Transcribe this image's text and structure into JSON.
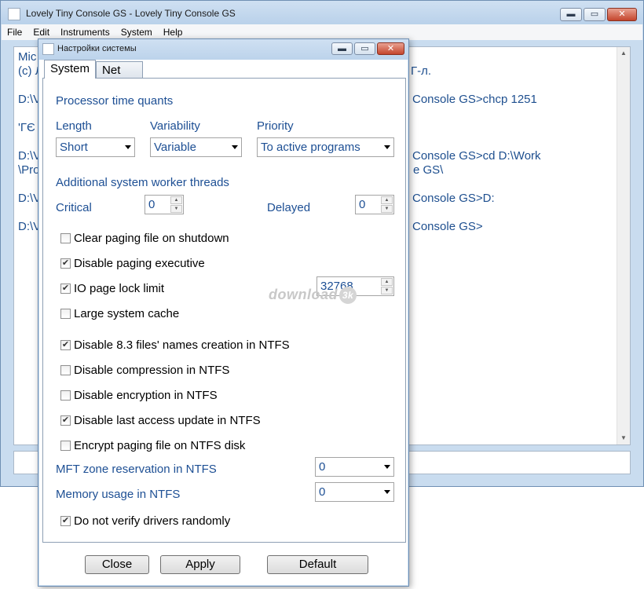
{
  "main_window": {
    "title": "Lovely Tiny Console GS - Lovely Tiny Console GS",
    "buttons": {
      "minimize": "▬",
      "maximize": "▭",
      "close": "✕"
    },
    "menu": [
      "File",
      "Edit",
      "Instruments",
      "System",
      "Help"
    ]
  },
  "console": {
    "left_lines": [
      "Mic",
      "(c) Л",
      "D:\\V",
      "'ГЄ",
      "D:\\V",
      "\\Pro",
      "D:\\V",
      "D:\\V"
    ],
    "right_lines": [
      "Г-л.",
      "Console GS>chcp 1251",
      "Console GS>cd D:\\Work",
      "e GS\\",
      "Console GS>D:",
      "Console GS>"
    ]
  },
  "dialog": {
    "title": "Настройки системы",
    "tabs": [
      "System",
      "Net"
    ],
    "section_quants": "Processor time quants",
    "length_label": "Length",
    "length_value": "Short",
    "variability_label": "Variability",
    "variability_value": "Variable",
    "priority_label": "Priority",
    "priority_value": "To active programs",
    "section_threads": "Additional system worker threads",
    "critical_label": "Critical",
    "critical_value": "0",
    "delayed_label": "Delayed",
    "delayed_value": "0",
    "checks": [
      {
        "label": "Clear paging file on shutdown",
        "checked": false
      },
      {
        "label": "Disable paging executive",
        "checked": true
      },
      {
        "label": "IO page lock limit",
        "checked": true
      },
      {
        "label": "Large system cache",
        "checked": false
      },
      {
        "label": "Disable 8.3 files' names creation in NTFS",
        "checked": true
      },
      {
        "label": "Disable compression in NTFS",
        "checked": false
      },
      {
        "label": "Disable encryption in NTFS",
        "checked": false
      },
      {
        "label": "Disable last access update in NTFS",
        "checked": true
      },
      {
        "label": "Encrypt paging file on NTFS disk",
        "checked": false
      }
    ],
    "io_limit_value": "32768",
    "mft_label": "MFT zone reservation in NTFS",
    "mft_value": "0",
    "memory_label": "Memory usage in NTFS",
    "memory_value": "0",
    "verify_drivers": {
      "label": "Do not verify drivers randomly",
      "checked": true
    },
    "buttons": {
      "close": "Close",
      "apply": "Apply",
      "default": "Default"
    }
  },
  "watermark": {
    "text": "download",
    "badge": "3k"
  },
  "checkmark": "✔"
}
